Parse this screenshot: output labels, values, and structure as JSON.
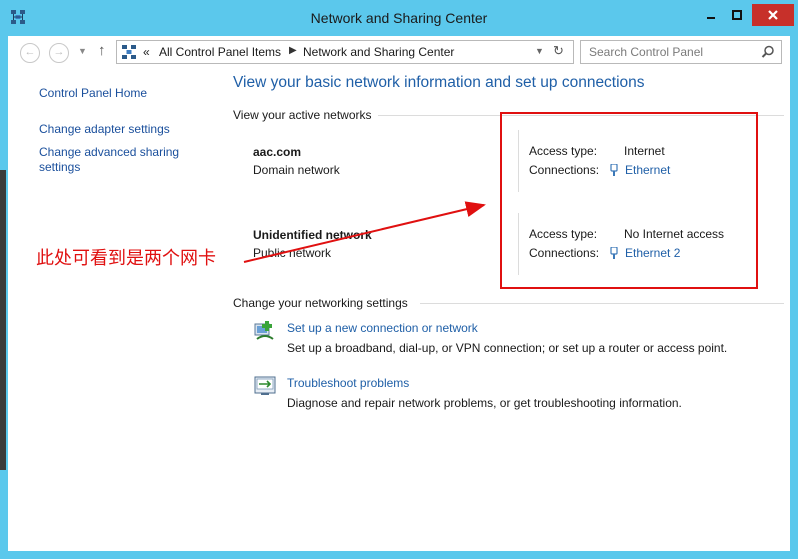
{
  "window": {
    "title": "Network and Sharing Center"
  },
  "address_bar": {
    "overflow": "«",
    "breadcrumbs": [
      "All Control Panel Items",
      "Network and Sharing Center"
    ],
    "search_placeholder": "Search Control Panel"
  },
  "sidebar": {
    "items": [
      {
        "label": "Control Panel Home"
      },
      {
        "label": "Change adapter settings"
      },
      {
        "label": "Change advanced sharing"
      },
      {
        "label": "settings"
      }
    ]
  },
  "main": {
    "heading": "View your basic network information and set up connections",
    "active_networks_label": "View your active networks",
    "networks": [
      {
        "name": "aac.com",
        "type": "Domain network",
        "access_label": "Access type:",
        "access_value": "Internet",
        "connections_label": "Connections:",
        "connection": "Ethernet"
      },
      {
        "name": "Unidentified network",
        "type": "Public network",
        "access_label": "Access type:",
        "access_value": "No Internet access",
        "connections_label": "Connections:",
        "connection": "Ethernet 2"
      }
    ],
    "settings_label": "Change your networking settings",
    "tasks": [
      {
        "link": "Set up a new connection or network",
        "description": "Set up a broadband, dial-up, or VPN connection; or set up a router or access point."
      },
      {
        "link": "Troubleshoot problems",
        "description": "Diagnose and repair network problems, or get troubleshooting information."
      }
    ]
  },
  "annotation": {
    "text": "此处可看到是两个网卡",
    "color": "#e01010"
  },
  "colors": {
    "titlebar": "#5bc8ec",
    "link": "#1f5fa7",
    "close_button": "#c7302a"
  },
  "icons": {
    "app": "network-center-icon",
    "back": "back-arrow-icon",
    "forward": "forward-arrow-icon",
    "up": "up-arrow-icon",
    "refresh": "refresh-icon",
    "search": "search-icon",
    "connection": "ethernet-plug-icon",
    "new_connection": "new-connection-icon",
    "troubleshoot": "troubleshoot-icon"
  }
}
